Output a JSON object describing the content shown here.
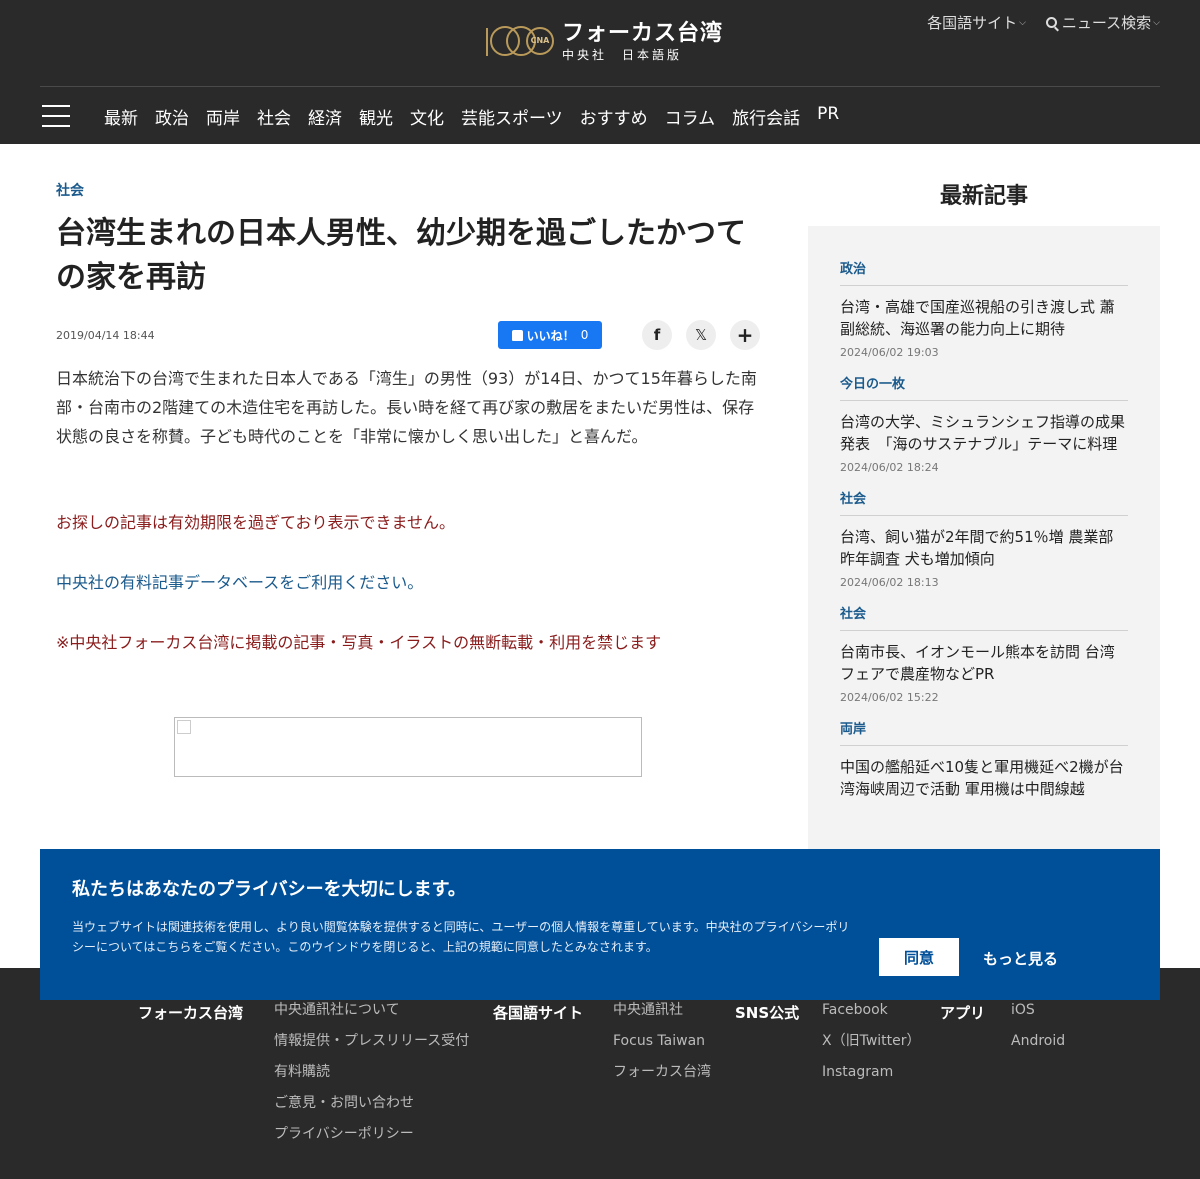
{
  "header": {
    "logo_title": "フォーカス台湾",
    "logo_sub": "中央社　日本語版",
    "logo_badge": "CNA",
    "lang_sites": "各国語サイト",
    "news_search": "ニュース検索",
    "nav": [
      "最新",
      "政治",
      "両岸",
      "社会",
      "経済",
      "観光",
      "文化",
      "芸能スポーツ",
      "おすすめ",
      "コラム",
      "旅行会話",
      "PR"
    ]
  },
  "article": {
    "category": "社会",
    "title": "台湾生まれの日本人男性、幼少期を過ごしたかつての家を再訪",
    "date": "2019/04/14 18:44",
    "like_label": "いいね！",
    "like_count": "0",
    "share_icons": [
      "facebook-icon",
      "x-icon",
      "plus-icon"
    ],
    "lede": "日本統治下の台湾で生まれた日本人である「湾生」の男性（93）が14日、かつて15年暮らした南部・台南市の2階建ての木造住宅を再訪した。長い時を経て再び家の敷居をまたいだ男性は、保存状態の良さを称賛。子ども時代のことを「非常に懐かしく思い出した」と喜んだ。",
    "expired_notice": "お探しの記事は有効期限を過ぎており表示できません。",
    "database_link": "中央社の有料記事データベースをご利用ください。",
    "copyright_notice": "※中央社フォーカス台湾に掲載の記事・写真・イラストの無断転載・利用を禁じます"
  },
  "sidebar": {
    "title": "最新記事",
    "items": [
      {
        "category": "政治",
        "headline": "台湾・高雄で国産巡視船の引き渡し式 蕭副総統、海巡署の能力向上に期待",
        "date": "2024/06/02 19:03"
      },
      {
        "category": "今日の一枚",
        "headline": "台湾の大学、ミシュランシェフ指導の成果発表　「海のサステナブル」テーマに料理",
        "date": "2024/06/02 18:24"
      },
      {
        "category": "社会",
        "headline": "台湾、飼い猫が2年間で約51％増 農業部昨年調査 犬も増加傾向",
        "date": "2024/06/02 18:13"
      },
      {
        "category": "社会",
        "headline": "台南市長、イオンモール熊本を訪問 台湾フェアで農産物などPR",
        "date": "2024/06/02 15:22"
      },
      {
        "category": "両岸",
        "headline": "中国の艦船延べ10隻と軍用機延べ2機が台湾海峡周辺で活動 軍用機は中間線越",
        "date": ""
      }
    ]
  },
  "privacy": {
    "title": "私たちはあなたのプライバシーを大切にします。",
    "body": "当ウェブサイトは関連技術を使用し、より良い閲覧体験を提供すると同時に、ユーザーの個人情報を尊重しています。中央社のプライバシーポリシーについてはこちらをご覧ください。このウインドウを閉じると、上記の規範に同意したとみなされます。",
    "agree": "同意",
    "more": "もっと見る"
  },
  "footer": {
    "col1_title": "フォーカス台湾",
    "col1_links": [
      "中央通訊社について",
      "情報提供・プレスリリース受付",
      "有料購読",
      "ご意見・お問い合わせ",
      "プライバシーポリシー"
    ],
    "col2_title": "各国語サイト",
    "col2_links": [
      "中央通訊社",
      "Focus Taiwan",
      "フォーカス台湾"
    ],
    "col3_title": "SNS公式",
    "col3_links": [
      "Facebook",
      "X（旧Twitter）",
      "Instagram"
    ],
    "col4_title": "アプリ",
    "col4_links": [
      "iOS",
      "Android"
    ]
  },
  "colors": {
    "header_bg": "#2a2a2a",
    "accent_blue": "#1a5a8c",
    "notice_red": "#8a1c1c",
    "privacy_bg": "#004f99",
    "like_blue": "#1877f2"
  }
}
